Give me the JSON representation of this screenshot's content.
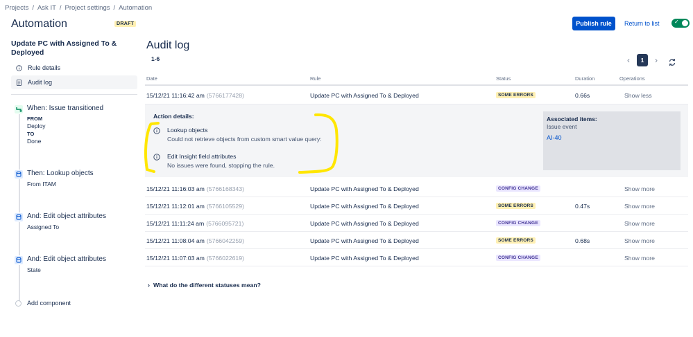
{
  "breadcrumb": [
    "Projects",
    "Ask IT",
    "Project settings",
    "Automation"
  ],
  "sidebar": {
    "title": "Automation",
    "badge": "DRAFT",
    "rule_name": "Update PC with Assigned To & Deployed",
    "nav": [
      {
        "label": "Rule details",
        "icon": "info-icon"
      },
      {
        "label": "Audit log",
        "icon": "document-icon",
        "active": true
      }
    ],
    "components": [
      {
        "title": "When: Issue transitioned",
        "icon": "trigger-icon",
        "lines": [
          "FROM",
          "Deploy",
          "TO",
          "Done"
        ]
      },
      {
        "title": "Then: Lookup objects",
        "icon": "database-icon",
        "lines": [
          "From ITAM"
        ]
      },
      {
        "title": "And: Edit object attributes",
        "icon": "database-icon",
        "lines": [
          "Assigned To"
        ]
      },
      {
        "title": "And: Edit object attributes",
        "icon": "database-icon",
        "lines": [
          "State"
        ]
      }
    ],
    "add_component": "Add component"
  },
  "header": {
    "publish": "Publish rule",
    "return": "Return to list",
    "enabled": true
  },
  "audit": {
    "title": "Audit log",
    "range": "1-6",
    "page": "1",
    "columns": [
      "Date",
      "Rule",
      "Status",
      "Duration",
      "Operations"
    ],
    "rows": [
      {
        "date": "15/12/21 11:16:42 am",
        "id": "(5766177428)",
        "rule": "Update PC with Assigned To & Deployed",
        "status": "SOME ERRORS",
        "duration": "0.66s",
        "op": "Show less"
      },
      {
        "date": "15/12/21 11:16:03 am",
        "id": "(5766168343)",
        "rule": "Update PC with Assigned To & Deployed",
        "status": "CONFIG CHANGE",
        "duration": "",
        "op": "Show more"
      },
      {
        "date": "15/12/21 11:12:01 am",
        "id": "(5766105529)",
        "rule": "Update PC with Assigned To & Deployed",
        "status": "SOME ERRORS",
        "duration": "0.47s",
        "op": "Show more"
      },
      {
        "date": "15/12/21 11:11:24 am",
        "id": "(5766095721)",
        "rule": "Update PC with Assigned To & Deployed",
        "status": "CONFIG CHANGE",
        "duration": "",
        "op": "Show more"
      },
      {
        "date": "15/12/21 11:08:04 am",
        "id": "(5766042259)",
        "rule": "Update PC with Assigned To & Deployed",
        "status": "SOME ERRORS",
        "duration": "0.68s",
        "op": "Show more"
      },
      {
        "date": "15/12/21 11:07:03 am",
        "id": "(5766022619)",
        "rule": "Update PC with Assigned To & Deployed",
        "status": "CONFIG CHANGE",
        "duration": "",
        "op": "Show more"
      }
    ],
    "details": {
      "label": "Action details:",
      "actions": [
        {
          "title": "Lookup objects",
          "message": "Could not retrieve objects from custom smart value query:"
        },
        {
          "title": "Edit Insight field attributes",
          "message": "No issues were found, stopping the rule."
        }
      ],
      "associated_label": "Associated items:",
      "associated_type": "Issue event",
      "associated_link": "AI-40"
    },
    "faq": "What do the different statuses mean?"
  },
  "colors": {
    "primary": "#0052cc",
    "toggle_on": "#00875a",
    "error_lozenge": "#fff0b3",
    "config_lozenge": "#eae6ff",
    "annotation": "#ffe600"
  }
}
